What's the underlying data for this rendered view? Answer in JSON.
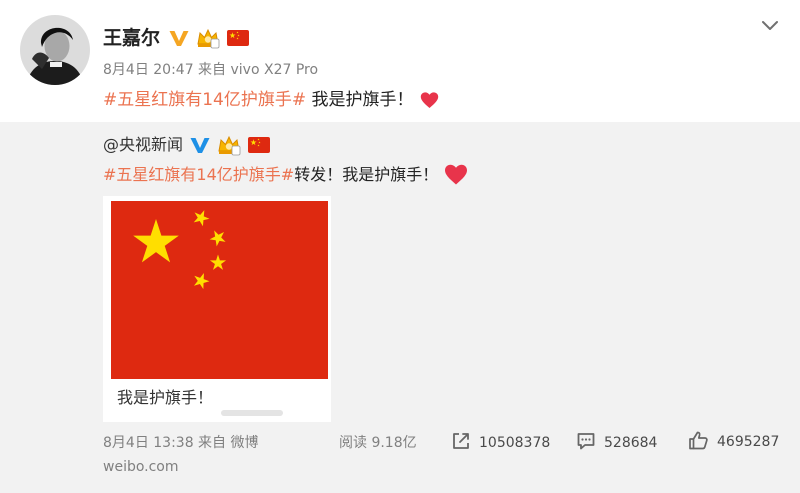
{
  "post": {
    "author": "王嘉尔",
    "badges": [
      "orange-v-icon",
      "crown-badge-icon",
      "china-flag-icon"
    ],
    "meta": "8月4日 20:47 来自 vivo X27 Pro",
    "hashtag": "#五星红旗有14亿护旗手#",
    "text": " 我是护旗手！",
    "end_icon": "heart-icon",
    "menu_icon": "chevron-down-icon"
  },
  "repost": {
    "author": "@央视新闻",
    "badges": [
      "blue-v-icon",
      "crown-badge-icon",
      "china-flag-icon"
    ],
    "hashtag": "#五星红旗有14亿护旗手#",
    "text": "转发！我是护旗手！",
    "end_icon": "heart-icon",
    "image": {
      "subject": "china-flag-image",
      "caption": "我是护旗手！"
    },
    "meta": "8月4日 13:38 来自 微博",
    "reads": "阅读 9.18亿",
    "actions": {
      "share": {
        "icon": "share-icon",
        "count": "10508378"
      },
      "comment": {
        "icon": "comment-icon",
        "count": "528684"
      },
      "like": {
        "icon": "thumbs-up-icon",
        "count": "4695287"
      }
    },
    "site": "weibo.com"
  },
  "colors": {
    "hashtag": "#eb7350",
    "flag_red": "#de2910",
    "flag_star": "#ffde00",
    "verified_orange": "#f5a623",
    "verified_blue": "#1e90e6",
    "background": "#f2f2f2",
    "heart": "#e8344b"
  }
}
